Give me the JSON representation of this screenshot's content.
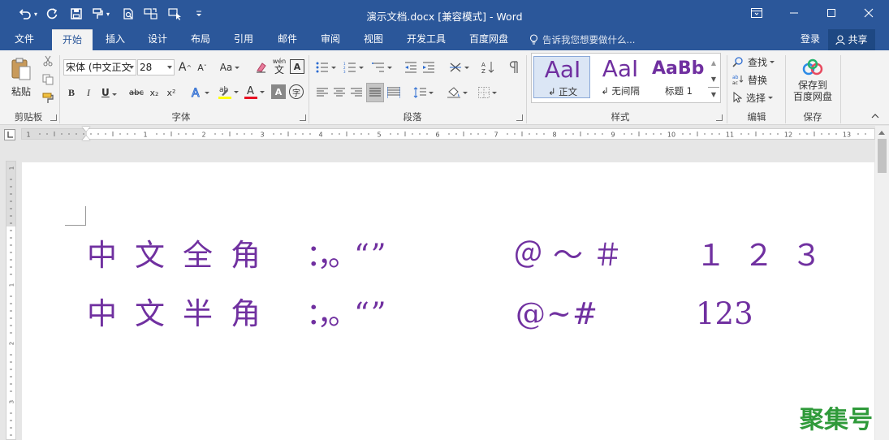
{
  "window": {
    "title": "演示文档.docx [兼容模式] - Word"
  },
  "quick_access": {
    "undo_icon": "undo-icon",
    "redo_icon": "redo-icon",
    "save_icon": "save-icon",
    "customize_icon": "customize-qat-icon"
  },
  "tabs": [
    {
      "label": "文件"
    },
    {
      "label": "开始"
    },
    {
      "label": "插入"
    },
    {
      "label": "设计"
    },
    {
      "label": "布局"
    },
    {
      "label": "引用"
    },
    {
      "label": "邮件"
    },
    {
      "label": "审阅"
    },
    {
      "label": "视图"
    },
    {
      "label": "开发工具"
    },
    {
      "label": "百度网盘"
    }
  ],
  "active_tab": "开始",
  "tell_me": "告诉我您想要做什么...",
  "account": {
    "login": "登录",
    "share": "共享"
  },
  "ribbon": {
    "clipboard": {
      "paste_label": "粘贴",
      "group": "剪贴板"
    },
    "font": {
      "name": "宋体 (中文正文",
      "size": "28",
      "bold": "B",
      "italic": "I",
      "underline": "U",
      "strike": "abc",
      "subscript": "x₂",
      "superscript": "x²",
      "change_case": "Aa",
      "grow": "A",
      "shrink": "A",
      "phonetic": "wén",
      "group": "字体"
    },
    "paragraph": {
      "group": "段落"
    },
    "styles": {
      "items": [
        {
          "sample": "AaI",
          "name": "↲ 正文"
        },
        {
          "sample": "AaI",
          "name": "↲ 无间隔"
        },
        {
          "sample": "AaBb",
          "name": "标题 1"
        }
      ],
      "group": "样式"
    },
    "editing": {
      "find": "查找",
      "replace": "替换",
      "select": "选择",
      "group": "编辑"
    },
    "save": {
      "label_line1": "保存到",
      "label_line2": "百度网盘",
      "group": "保存"
    }
  },
  "ruler": {
    "numbers": [
      "1",
      "1",
      "2",
      "3",
      "4",
      "5",
      "6",
      "7",
      "8",
      "9",
      "10",
      "11",
      "12",
      "13"
    ],
    "vertical_numbers": [
      "1",
      "1",
      "2",
      "3"
    ]
  },
  "document": {
    "lines": [
      {
        "label": "中文全角",
        "punct": "：，。“ ”",
        "symbols": "＠～＃",
        "digits": "１２３"
      },
      {
        "label": "中文半角",
        "punct": "：，。“ ”",
        "symbols": "@~#",
        "digits": "123"
      }
    ],
    "text_color": "#7030a0"
  },
  "watermark": "聚集号",
  "colors": {
    "titlebar": "#2b579a",
    "font_color_bar": "#e81123",
    "highlight_bar": "#ffff00",
    "watermark": "#2f9a3a"
  }
}
